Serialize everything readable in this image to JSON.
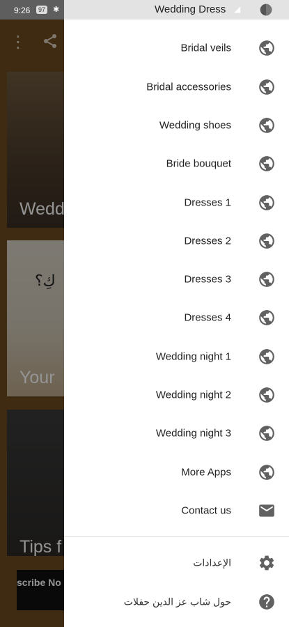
{
  "status_bar": {
    "time": "9:26",
    "battery": "97",
    "title": "Wedding Dress"
  },
  "background": {
    "card1_text": "Weddi",
    "card2_text": "Your",
    "card2_arabic": "كِ؟",
    "card3_text": "Tips f",
    "subscribe_text": "scribe No"
  },
  "drawer": {
    "items": [
      {
        "label": "Bridal veils",
        "icon": "globe-icon"
      },
      {
        "label": "Bridal accessories",
        "icon": "globe-icon"
      },
      {
        "label": "Wedding shoes",
        "icon": "globe-icon"
      },
      {
        "label": "Bride bouquet",
        "icon": "globe-icon"
      },
      {
        "label": "Dresses 1",
        "icon": "globe-icon"
      },
      {
        "label": "Dresses 2",
        "icon": "globe-icon"
      },
      {
        "label": "Dresses 3",
        "icon": "globe-icon"
      },
      {
        "label": "Dresses 4",
        "icon": "globe-icon"
      },
      {
        "label": "Wedding night 1",
        "icon": "globe-icon"
      },
      {
        "label": "Wedding night 2",
        "icon": "globe-icon"
      },
      {
        "label": "Wedding night 3",
        "icon": "globe-icon"
      },
      {
        "label": "More Apps",
        "icon": "globe-icon"
      },
      {
        "label": "Contact us",
        "icon": "mail-icon"
      }
    ],
    "settings": {
      "label": "الإعدادات",
      "icon": "gear-icon"
    },
    "about": {
      "label": "حول شاب عز الدين حفلات",
      "icon": "help-icon"
    }
  }
}
